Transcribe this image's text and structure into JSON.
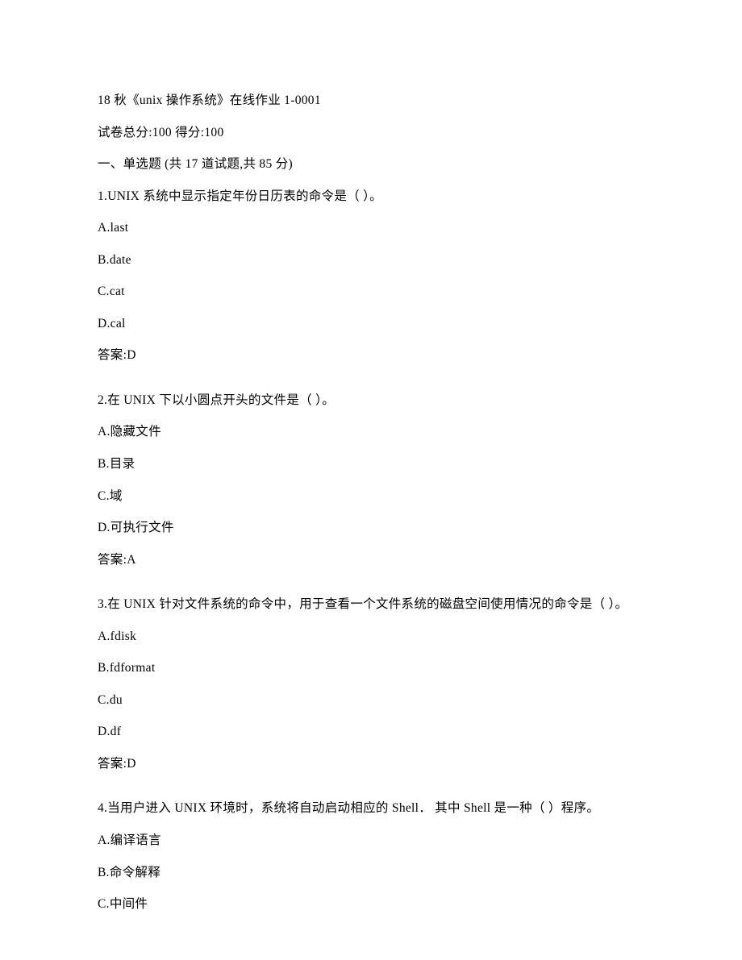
{
  "header": {
    "title": "18 秋《unix 操作系统》在线作业 1-0001",
    "score_line": "试卷总分:100   得分:100"
  },
  "section": {
    "heading": "一、单选题 (共 17 道试题,共 85 分)"
  },
  "questions": [
    {
      "stem": "1.UNIX 系统中显示指定年份日历表的命令是（ ）。",
      "options": [
        "A.last",
        "B.date",
        "C.cat",
        "D.cal"
      ],
      "answer": "答案:D"
    },
    {
      "stem": "2.在 UNIX 下以小圆点开头的文件是（ ）。",
      "options": [
        "A.隐藏文件",
        "B.目录",
        "C.域",
        "D.可执行文件"
      ],
      "answer": "答案:A"
    },
    {
      "stem": "3.在 UNIX 针对文件系统的命令中，用于查看一个文件系统的磁盘空间使用情况的命令是（ ）。",
      "options": [
        "A.fdisk",
        "B.fdformat",
        "C.du",
        "D.df"
      ],
      "answer": "答案:D"
    },
    {
      "stem": "4.当用户进入 UNIX 环境时，系统将自动启动相应的 Shell． 其中 Shell 是一种（ ）程序。",
      "options": [
        "A.编译语言",
        "B.命令解释",
        "C.中间件"
      ],
      "answer": ""
    }
  ]
}
